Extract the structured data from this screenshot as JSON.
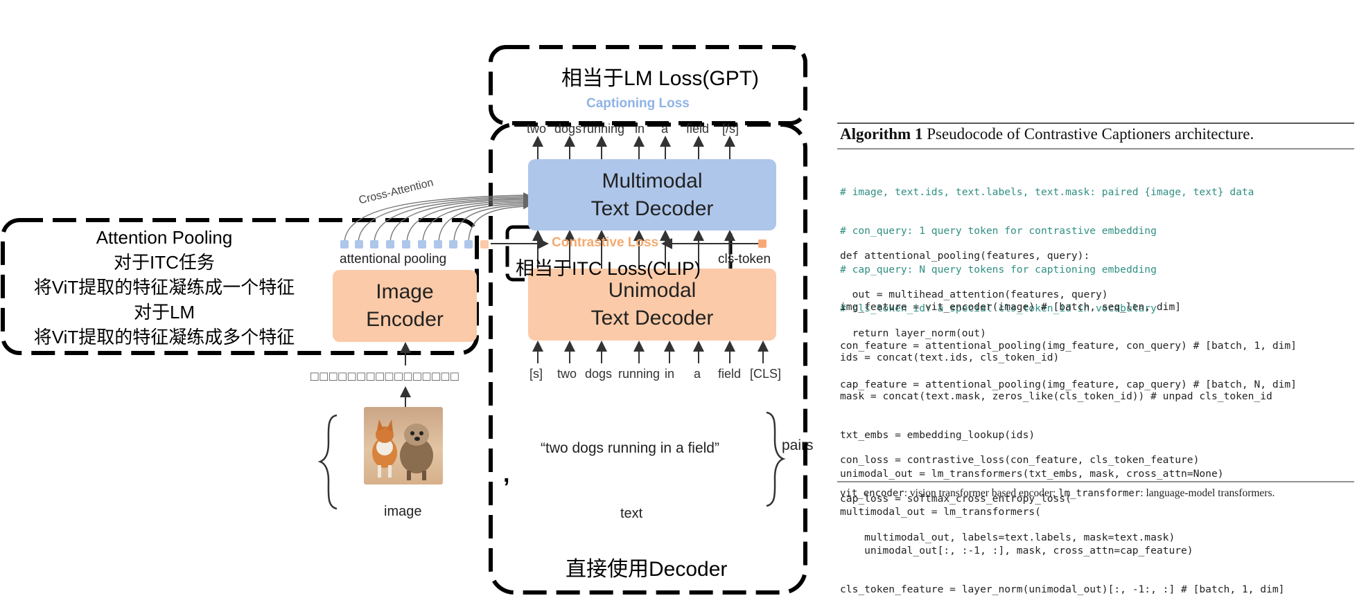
{
  "annotations": {
    "lm_loss": "相当于LM Loss(GPT)",
    "itc_loss": "相当于ITC Loss(CLIP)",
    "decoder_note": "直接使用Decoder",
    "pooling_note": [
      "Attention Pooling",
      "对于ITC任务",
      "将ViT提取的特征凝练成一个特征",
      "对于LM",
      "将ViT提取的特征凝练成多个特征"
    ]
  },
  "diagram": {
    "captioning_loss": "Captioning Loss",
    "contrastive_loss": "Contrastive Loss",
    "cross_attention": "Cross-Attention",
    "attentional_pooling": "attentional pooling",
    "cls_token": "cls-token",
    "multimodal_decoder": [
      "Multimodal",
      "Text Decoder"
    ],
    "unimodal_decoder": [
      "Unimodal",
      "Text Decoder"
    ],
    "image_encoder": [
      "Image",
      "Encoder"
    ],
    "output_tokens": [
      "two",
      "dogs",
      "running",
      "in",
      "a",
      "field",
      "[/s]"
    ],
    "input_tokens": [
      "[s]",
      "two",
      "dogs",
      "running",
      "in",
      "a",
      "field",
      "[CLS]"
    ],
    "caption_text": "“two dogs running in a field”",
    "pairs_label": "pairs",
    "image_label": "image",
    "text_label": "text",
    "comma": ","
  },
  "algorithm": {
    "title_bold": "Algorithm 1",
    "title_rest": " Pseudocode of Contrastive Captioners architecture.",
    "comments": [
      "# image, text.ids, text.labels, text.mask: paired {image, text} data",
      "# con_query: 1 query token for contrastive embedding",
      "# cap_query: N query tokens for captioning embedding",
      "# cls_token_id: a special cls_token_id in vocabulary"
    ],
    "code_blocks": [
      [
        "def attentional_pooling(features, query):",
        "  out = multihead_attention(features, query)",
        "  return layer_norm(out)"
      ],
      [
        "img_feature = vit_encoder(image) # [batch, seq_len, dim]",
        "con_feature = attentional_pooling(img_feature, con_query) # [batch, 1, dim]",
        "cap_feature = attentional_pooling(img_feature, cap_query) # [batch, N, dim]"
      ],
      [
        "ids = concat(text.ids, cls_token_id)",
        "mask = concat(text.mask, zeros_like(cls_token_id)) # unpad cls_token_id",
        "txt_embs = embedding_lookup(ids)",
        "unimodal_out = lm_transformers(txt_embs, mask, cross_attn=None)",
        "multimodal_out = lm_transformers(",
        "    unimodal_out[:, :-1, :], mask, cross_attn=cap_feature)",
        "cls_token_feature = layer_norm(unimodal_out)[:, -1:, :] # [batch, 1, dim]"
      ],
      [
        "con_loss = contrastive_loss(con_feature, cls_token_feature)",
        "cap_loss = softmax_cross_entropy_loss(",
        "    multimodal_out, labels=text.labels, mask=text.mask)"
      ]
    ],
    "footnote_parts": [
      "vit_encoder",
      ": vision transformer based encoder; ",
      "lm_transformer",
      ": language-model transformers."
    ]
  },
  "colors": {
    "blue_box": "#aec6ea",
    "peach_box": "#fbcaa8",
    "captioning_text": "#8fb3e6",
    "contrastive_text": "#f4a96e",
    "comment_green": "#2f8f83"
  },
  "icons": [
    "photo-of-two-dogs"
  ]
}
